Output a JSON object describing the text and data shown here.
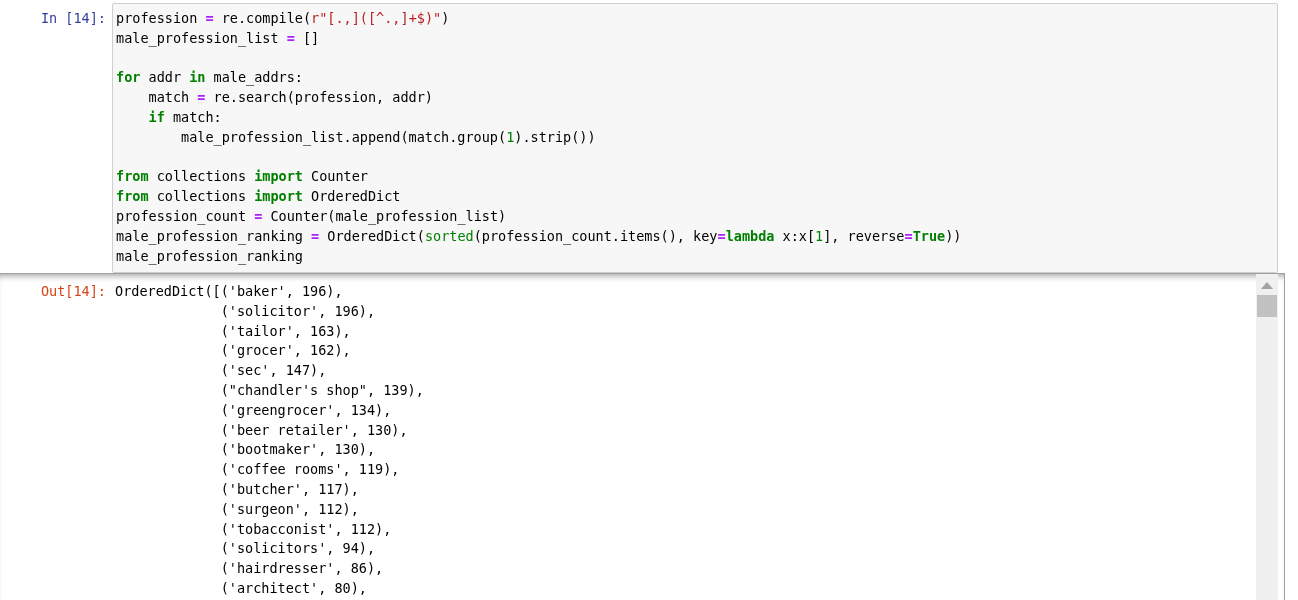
{
  "input_cell": {
    "prompt": "In [14]:",
    "lines": [
      {
        "kind": "code",
        "tokens": [
          {
            "text": "profession ",
            "kind": "plain"
          },
          {
            "text": "=",
            "kind": "op"
          },
          {
            "text": " re.compile(",
            "kind": "plain"
          },
          {
            "text": "r\"[.,]([^.,]+$)\"",
            "kind": "str"
          },
          {
            "text": ")",
            "kind": "plain"
          }
        ]
      },
      {
        "kind": "code",
        "tokens": [
          {
            "text": "male_profession_list ",
            "kind": "plain"
          },
          {
            "text": "=",
            "kind": "op"
          },
          {
            "text": " []",
            "kind": "plain"
          }
        ]
      },
      {
        "kind": "blank"
      },
      {
        "kind": "code",
        "tokens": [
          {
            "text": "for",
            "kind": "kw"
          },
          {
            "text": " addr ",
            "kind": "plain"
          },
          {
            "text": "in",
            "kind": "kw"
          },
          {
            "text": " male_addrs:",
            "kind": "plain"
          }
        ]
      },
      {
        "kind": "code",
        "tokens": [
          {
            "text": "    match ",
            "kind": "plain"
          },
          {
            "text": "=",
            "kind": "op"
          },
          {
            "text": " re.search(profession, addr)",
            "kind": "plain"
          }
        ]
      },
      {
        "kind": "code",
        "tokens": [
          {
            "text": "    if",
            "kind": "kw"
          },
          {
            "text": " match:",
            "kind": "plain"
          }
        ]
      },
      {
        "kind": "code",
        "tokens": [
          {
            "text": "        male_profession_list.append(match.group(",
            "kind": "plain"
          },
          {
            "text": "1",
            "kind": "num"
          },
          {
            "text": ").strip())",
            "kind": "plain"
          }
        ]
      },
      {
        "kind": "blank"
      },
      {
        "kind": "code",
        "tokens": [
          {
            "text": "from",
            "kind": "kw"
          },
          {
            "text": " collections ",
            "kind": "plain"
          },
          {
            "text": "import",
            "kind": "kw"
          },
          {
            "text": " Counter",
            "kind": "plain"
          }
        ]
      },
      {
        "kind": "code",
        "tokens": [
          {
            "text": "from",
            "kind": "kw"
          },
          {
            "text": " collections ",
            "kind": "plain"
          },
          {
            "text": "import",
            "kind": "kw"
          },
          {
            "text": " OrderedDict",
            "kind": "plain"
          }
        ]
      },
      {
        "kind": "code",
        "tokens": [
          {
            "text": "profession_count ",
            "kind": "plain"
          },
          {
            "text": "=",
            "kind": "op"
          },
          {
            "text": " Counter(male_profession_list)",
            "kind": "plain"
          }
        ]
      },
      {
        "kind": "code",
        "tokens": [
          {
            "text": "male_profession_ranking ",
            "kind": "plain"
          },
          {
            "text": "=",
            "kind": "op"
          },
          {
            "text": " OrderedDict(",
            "kind": "plain"
          },
          {
            "text": "sorted",
            "kind": "builtin"
          },
          {
            "text": "(profession_count.items(), key",
            "kind": "plain"
          },
          {
            "text": "=",
            "kind": "op"
          },
          {
            "text": "lambda",
            "kind": "kw"
          },
          {
            "text": " x:x[",
            "kind": "plain"
          },
          {
            "text": "1",
            "kind": "num"
          },
          {
            "text": "], reverse",
            "kind": "plain"
          },
          {
            "text": "=",
            "kind": "op"
          },
          {
            "text": "True",
            "kind": "kw"
          },
          {
            "text": "))",
            "kind": "plain"
          }
        ]
      },
      {
        "kind": "code",
        "tokens": [
          {
            "text": "male_profession_ranking",
            "kind": "plain"
          }
        ]
      }
    ]
  },
  "output_cell": {
    "prompt": "Out[14]:",
    "head": "OrderedDict([",
    "lines": [
      "('baker', 196),",
      "('solicitor', 196),",
      "('tailor', 163),",
      "('grocer', 162),",
      "('sec', 147),",
      "(\"chandler's shop\", 139),",
      "('greengrocer', 134),",
      "('beer retailer', 130),",
      "('bootmaker', 130),",
      "('coffee rooms', 119),",
      "('butcher', 117),",
      "('surgeon', 112),",
      "('tobacconist', 112),",
      "('solicitors', 94),",
      "('hairdresser', 86),",
      "('architect', 80),"
    ]
  }
}
